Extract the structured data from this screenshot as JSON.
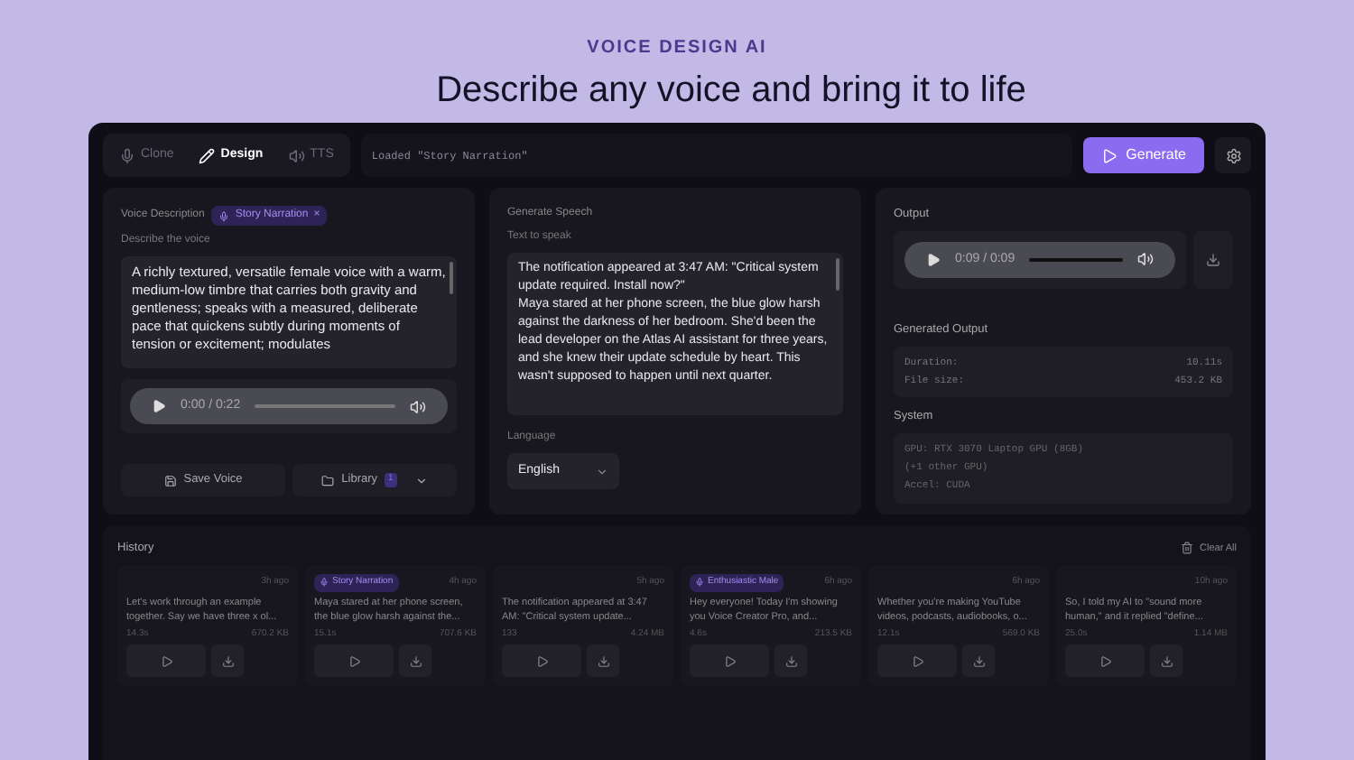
{
  "eyebrow": "VOICE DESIGN AI",
  "headline": "Describe any voice and bring it to life",
  "tabs": [
    {
      "label": "Clone",
      "selected": false
    },
    {
      "label": "Design",
      "selected": true
    },
    {
      "label": "TTS",
      "selected": false
    }
  ],
  "status": "Loaded \"Story Narration\"",
  "generate_button": "Generate",
  "voice_panel": {
    "title": "Voice Description",
    "tag": "Story Narration",
    "tag_close": "×",
    "field_label": "Describe the voice",
    "description": "A richly textured, versatile female voice with a warm, medium-low timbre that carries both gravity and gentleness; speaks with a measured, deliberate pace that quickens subtly during moments of tension or excitement; modulates",
    "player": {
      "time": "0:00 / 0:22"
    },
    "save_button": "Save Voice",
    "library_button": "Library",
    "library_count": "1"
  },
  "speech_panel": {
    "title": "Generate Speech",
    "field_label": "Text to speak",
    "text": "The notification appeared at 3:47 AM: \"Critical system update required. Install now?\"\nMaya stared at her phone screen, the blue glow harsh against the darkness of her bedroom. She'd been the lead developer on the Atlas AI assistant for three years, and she knew their update schedule by heart. This wasn't supposed to happen until next quarter.",
    "language_label": "Language",
    "language": "English"
  },
  "output_panel": {
    "title": "Output",
    "player": {
      "time": "0:09 / 0:09"
    },
    "generated_title": "Generated Output",
    "stats": [
      {
        "label": "Duration:",
        "value": "10.11s"
      },
      {
        "label": "File size:",
        "value": "453.2 KB"
      }
    ],
    "system_title": "System",
    "system_lines": [
      "GPU: RTX 3070 Laptop GPU (8GB)",
      "(+1 other GPU)",
      "Accel: CUDA"
    ]
  },
  "history": {
    "title": "History",
    "clear_button": "Clear All",
    "items": [
      {
        "age": "3h ago",
        "text": "Let's work through an example together. Say we have three x ol...",
        "duration": "14.3s",
        "size": "670.2 KB"
      },
      {
        "tag": "Story Narration",
        "age": "4h ago",
        "text": "Maya stared at her phone screen, the blue glow harsh against the...",
        "duration": "15.1s",
        "size": "707.6 KB"
      },
      {
        "age": "5h ago",
        "text": "The notification appeared at 3:47 AM: \"Critical system update...",
        "duration": "133",
        "size": "4.24 MB"
      },
      {
        "tag": "Enthusiastic Male",
        "age": "6h ago",
        "text": "Hey everyone! Today I'm showing you Voice Creator Pro, and...",
        "duration": "4.6s",
        "size": "213.5 KB"
      },
      {
        "age": "6h ago",
        "text": "Whether you're making YouTube videos, podcasts, audiobooks, o...",
        "duration": "12.1s",
        "size": "569.0 KB"
      },
      {
        "age": "10h ago",
        "text": "So, I told my AI to \"sound more human,\" and it replied \"define...",
        "duration": "25.0s",
        "size": "1.14 MB"
      }
    ]
  }
}
